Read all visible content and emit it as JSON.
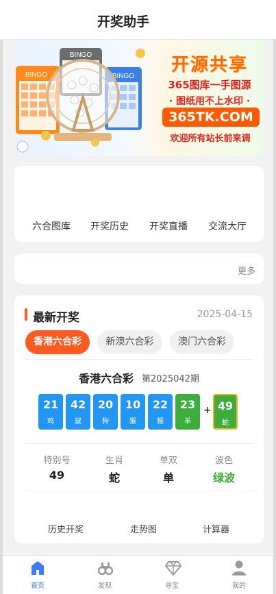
{
  "header": {
    "title": "开奖助手"
  },
  "banner": {
    "headline": "开源共享",
    "line1": "365图库一手图源",
    "line2": "· 图纸用不上水印 ·",
    "site": "365TK.COM",
    "line3": "欢迎所有站长前来调",
    "art_labels": [
      "BINGO",
      "BINGO",
      "BINGO"
    ]
  },
  "nav": {
    "items": [
      "六合图库",
      "开奖历史",
      "开奖直播",
      "交流大厅"
    ]
  },
  "notice": {
    "more": "更多"
  },
  "latest": {
    "title": "最新开奖",
    "date": "2025-04-15",
    "tabs": [
      "香港六合彩",
      "新澳六合彩",
      "澳门六合彩"
    ],
    "active_tab": 0,
    "lottery_name": "香港六合彩",
    "issue": "第2025042期",
    "balls": [
      {
        "num": "21",
        "zodiac": "鸡",
        "color": "#2196f3"
      },
      {
        "num": "42",
        "zodiac": "鼠",
        "color": "#2196f3"
      },
      {
        "num": "20",
        "zodiac": "狗",
        "color": "#2196f3"
      },
      {
        "num": "10",
        "zodiac": "猴",
        "color": "#2196f3"
      },
      {
        "num": "22",
        "zodiac": "猴",
        "color": "#2196f3"
      },
      {
        "num": "23",
        "zodiac": "羊",
        "color": "#3cae3c"
      }
    ],
    "plus": "+",
    "special_ball": {
      "num": "49",
      "zodiac": "蛇",
      "color": "#3cae3c"
    },
    "stats": {
      "headers": [
        "特别号",
        "生肖",
        "单双",
        "波色"
      ],
      "values": [
        "49",
        "蛇",
        "单",
        "绿波"
      ]
    },
    "links": [
      "历史开奖",
      "走势图",
      "计算器"
    ]
  },
  "bottom_nav": {
    "items": [
      {
        "label": "首页",
        "icon": "home-icon",
        "active": true
      },
      {
        "label": "发现",
        "icon": "binoculars-icon",
        "active": false
      },
      {
        "label": "寻宝",
        "icon": "diamond-icon",
        "active": false
      },
      {
        "label": "我的",
        "icon": "user-icon",
        "active": false
      }
    ]
  },
  "colors": {
    "accent": "#ff5a1f",
    "ball_blue": "#2196f3",
    "ball_green": "#3cae3c",
    "nav_active": "#3a7bfa"
  }
}
